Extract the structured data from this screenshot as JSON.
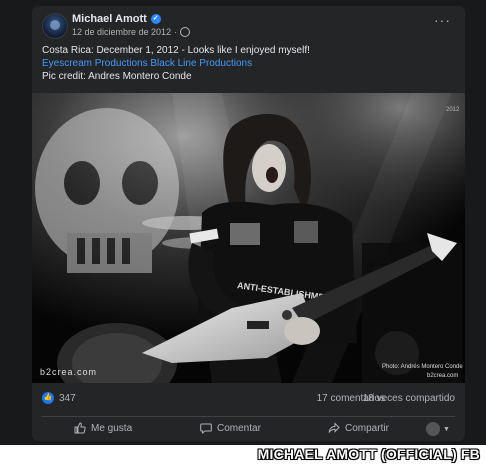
{
  "post": {
    "author": "Michael Amott",
    "date": "12 de diciembre de 2012",
    "date_separator": "·",
    "text_line1": "Costa Rica: December 1, 2012 - Looks like I enjoyed myself!",
    "link1": "Eyescream Productions",
    "link2": "Black Line Productions",
    "text_line3": "Pic credit: Andres Montero Conde"
  },
  "photo": {
    "year": "2012",
    "logo_text": "b2crea.com",
    "credit_line1": "Photo: Andrés Montero Conde",
    "credit_line2": "b2crea.com",
    "shirt_text": "ANTI-ESTABLISHMENT"
  },
  "stats": {
    "reactions": "347",
    "comments": "17 comentarios",
    "shares": "18 veces compartido"
  },
  "actions": {
    "like": "Me gusta",
    "comment": "Comentar",
    "share": "Compartir"
  },
  "watermark": "MICHAEL AMOTT (OFFICIAL) FB",
  "colors": {
    "background": "#18191a",
    "card": "#242526",
    "link": "#4599ff",
    "like_blue": "#1877f2"
  },
  "icons": [
    "verified-badge-icon",
    "globe-icon",
    "more-options-icon",
    "like-reaction-icon",
    "thumbs-up-icon",
    "comment-icon",
    "share-icon",
    "chevron-down-icon"
  ]
}
